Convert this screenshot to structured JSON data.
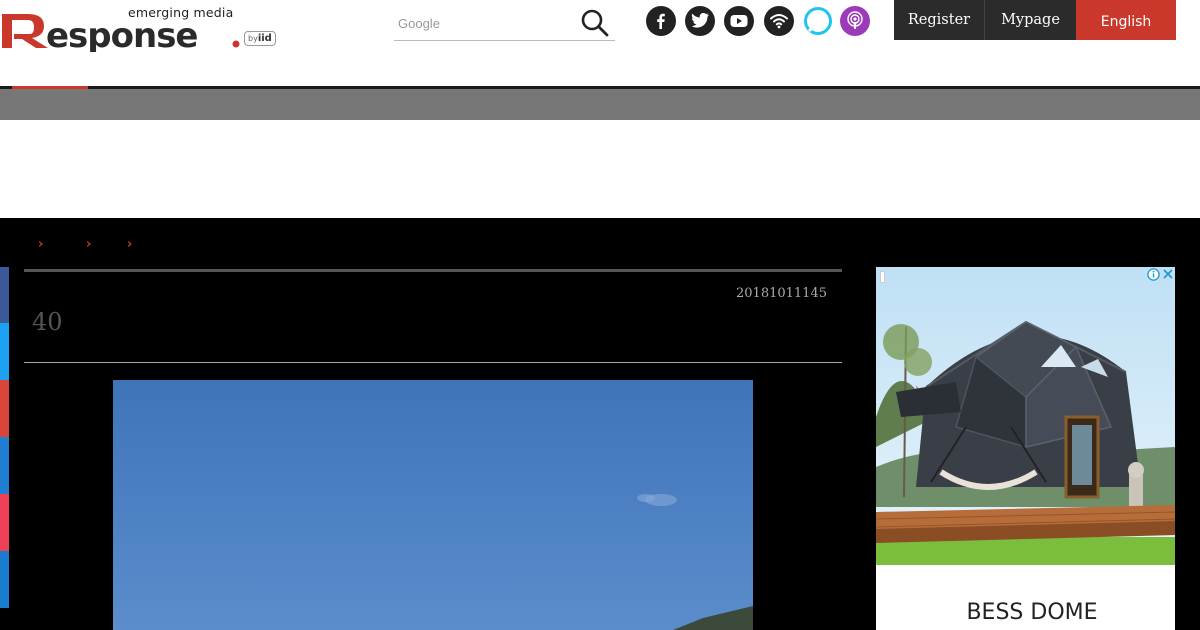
{
  "header": {
    "logo": {
      "tagline": "emerging media",
      "wordmark": "Response.",
      "by": "by",
      "iid": "iid"
    },
    "search": {
      "placeholder": "Google"
    },
    "social_icons": [
      "facebook-icon",
      "twitter-icon",
      "youtube-icon",
      "rss-icon",
      "alexa-icon",
      "podcast-icon"
    ],
    "buttons": {
      "register": "Register",
      "mypage": "Mypage",
      "english": "English"
    }
  },
  "breadcrumb": {
    "separators": [
      "›",
      "›",
      "›"
    ]
  },
  "article": {
    "date": "20181011145",
    "title": "40"
  },
  "side_ad": {
    "title": "BESS DOME",
    "ad_choices_icon": "ad-choices-icon"
  },
  "colors": {
    "accent": "#c9382b",
    "facebook": "#3b5998",
    "twitter": "#1da1f2",
    "google": "#d9453a",
    "hatena": "#1f7ed1",
    "pocket": "#ee4056",
    "line": "#1a7ccf"
  }
}
